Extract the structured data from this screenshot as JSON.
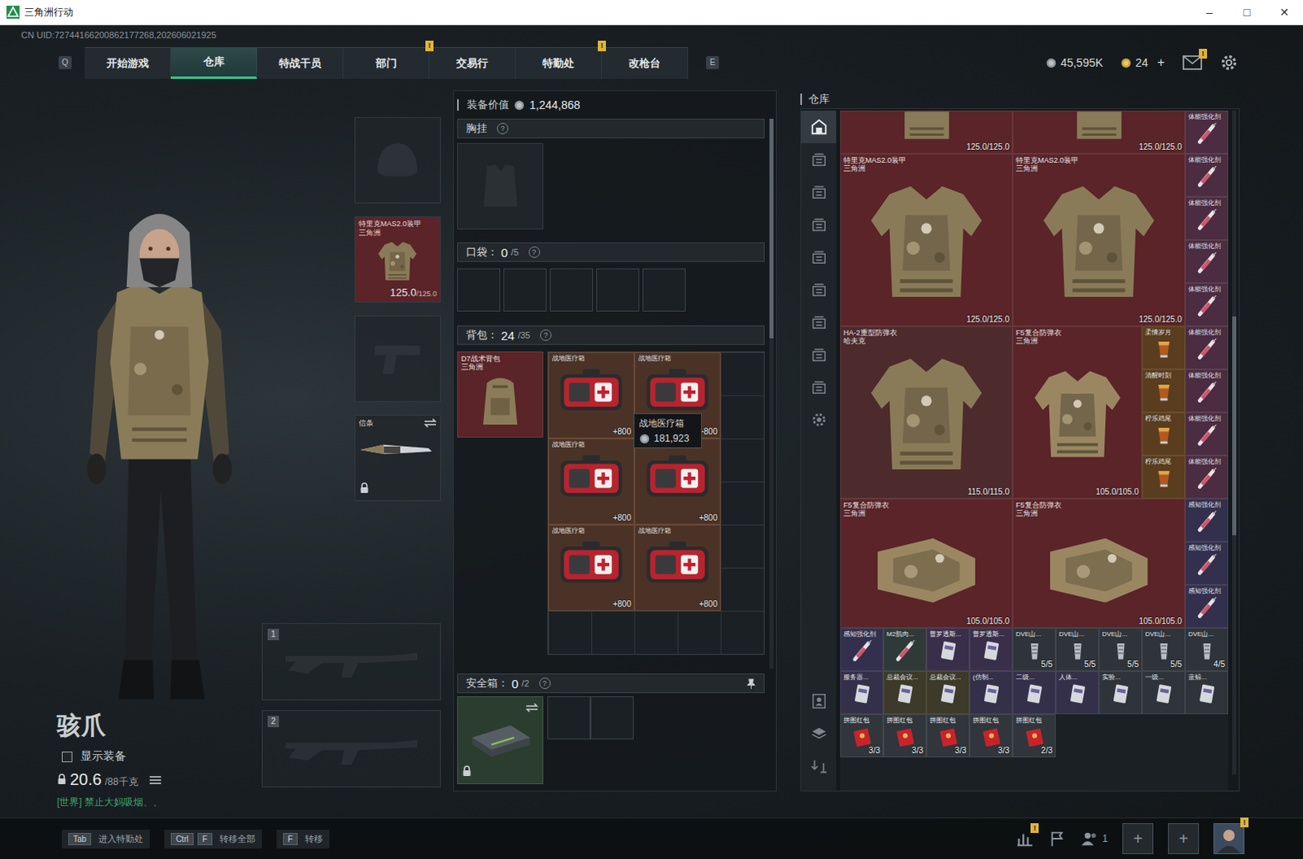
{
  "window": {
    "title": "三角洲行动",
    "controls": [
      "–",
      "□",
      "✕"
    ]
  },
  "uid": "CN UID:72744166200862177268,202606021925",
  "nav": {
    "left_key": "Q",
    "right_key": "E",
    "tabs": [
      {
        "label": "开始游戏",
        "selected": false,
        "badge": ""
      },
      {
        "label": "仓库",
        "selected": true,
        "badge": ""
      },
      {
        "label": "特战干员",
        "selected": false,
        "badge": ""
      },
      {
        "label": "部门",
        "selected": false,
        "badge": "!"
      },
      {
        "label": "交易行",
        "selected": false,
        "badge": ""
      },
      {
        "label": "特勤处",
        "selected": false,
        "badge": "!"
      },
      {
        "label": "改枪台",
        "selected": false,
        "badge": ""
      }
    ]
  },
  "wallet": {
    "coins": "45,595K",
    "tickets": "24",
    "add": "+",
    "mail_badge": "!"
  },
  "operator": {
    "name": "骇爪",
    "show_gear": {
      "label": "显示装备",
      "checked": false
    },
    "weight": "20.6",
    "weight_max": "/88千克",
    "chat": "[世界] 禁止大妈吸烟、、"
  },
  "equipment": [
    {
      "kind": "helmet",
      "filled": false
    },
    {
      "kind": "armor",
      "filled": true,
      "name": "特里克MAS2.0装甲",
      "brand": "三角洲",
      "durability": "125.0",
      "durability_max": "/125.0",
      "color": "#5a2428"
    },
    {
      "kind": "pistol",
      "filled": false
    },
    {
      "kind": "melee",
      "filled": true,
      "name": "信条",
      "locked": true
    }
  ],
  "weapons": [
    {
      "number": "1",
      "filled": false
    },
    {
      "number": "2",
      "filled": false
    }
  ],
  "loadout": {
    "value_label": "装备价值",
    "value": "1,244,868",
    "rig": {
      "label": "胸挂",
      "help": "?",
      "filled": false
    },
    "pockets": {
      "label": "口袋：",
      "count": "0",
      "capacity": "/5",
      "help": "?",
      "slot_count": 5
    },
    "backpack": {
      "label": "背包：",
      "count": "24",
      "capacity": "/35",
      "help": "?",
      "bag": {
        "name": "D7战术背包",
        "brand": "三角洲",
        "color": "#5a2428"
      },
      "items": [
        {
          "name": "战地医疗箱",
          "amount": "+800",
          "color": "#4a3326"
        },
        {
          "name": "战地医疗箱",
          "amount": "+800",
          "color": "#4a3326"
        },
        {
          "name": "战地医疗箱",
          "amount": "+800",
          "color": "#4a3326"
        },
        {
          "name": "战地医疗箱",
          "amount": "+800",
          "color": "#4a3326"
        },
        {
          "name": "战地医疗箱",
          "amount": "+800",
          "color": "#4a3326"
        },
        {
          "name": "战地医疗箱",
          "amount": "+800",
          "color": "#4a3326"
        }
      ],
      "tooltip": {
        "name": "战地医疗箱",
        "value": "181,923"
      }
    },
    "secure": {
      "label": "安全箱：",
      "count": "0",
      "capacity": "/2",
      "help": "?",
      "locked": true,
      "slot_count": 2
    },
    "scrollbar": {
      "position": 0.0,
      "level": 0.4
    }
  },
  "stash": {
    "title": "仓库",
    "sidebar": [
      {
        "kind": "home",
        "selected": true
      },
      {
        "kind": "tab",
        "selected": false
      },
      {
        "kind": "tab",
        "selected": false
      },
      {
        "kind": "tab",
        "selected": false
      },
      {
        "kind": "tab",
        "selected": false
      },
      {
        "kind": "tab",
        "selected": false
      },
      {
        "kind": "tab",
        "selected": false
      },
      {
        "kind": "tab",
        "selected": false
      },
      {
        "kind": "tab",
        "selected": false
      },
      {
        "kind": "settings",
        "selected": false
      }
    ],
    "sidebar_bottom": [
      {
        "kind": "operator"
      },
      {
        "kind": "layers"
      },
      {
        "kind": "transfer"
      }
    ],
    "scrollbar": {
      "position": 0.31,
      "level": 0.33
    },
    "items": [
      {
        "kind": "armor-cut",
        "value": "125.0/125.0",
        "color": "#5a2428"
      },
      {
        "kind": "armor-cut",
        "value": "125.0/125.0",
        "color": "#5a2428"
      },
      {
        "kind": "syringe",
        "name": "体能强化剂",
        "color": "#4b2c40"
      },
      {
        "kind": "armor",
        "name": "特里克MAS2.0装甲",
        "brand": "三角洲",
        "value": "125.0/125.0",
        "color": "#5a2428"
      },
      {
        "kind": "armor",
        "name": "特里克MAS2.0装甲",
        "brand": "三角洲",
        "value": "125.0/125.0",
        "color": "#5a2428"
      },
      {
        "kind": "syringe",
        "name": "体能强化剂",
        "color": "#4b2c40"
      },
      {
        "kind": "syringe",
        "name": "体能强化剂",
        "color": "#4b2c40"
      },
      {
        "kind": "syringe",
        "name": "体能强化剂",
        "color": "#4b2c40"
      },
      {
        "kind": "syringe",
        "name": "体能强化剂",
        "color": "#4b2c40"
      },
      {
        "kind": "armor",
        "name": "HA-2重型防弹衣",
        "brand": "哈夫克",
        "value": "115.0/115.0",
        "color": "#4d2a2c"
      },
      {
        "kind": "vest",
        "name": "F5复合防弹衣",
        "brand": "三角洲",
        "value": "105.0/105.0",
        "color": "#5a2428"
      },
      {
        "kind": "drink",
        "name": "柔情岁月",
        "color": "#5a3d1e"
      },
      {
        "kind": "syringe",
        "name": "体能强化剂",
        "color": "#4b2c40"
      },
      {
        "kind": "drink",
        "name": "清醒时刻",
        "color": "#5a3d1e"
      },
      {
        "kind": "syringe",
        "name": "体能强化剂",
        "color": "#4b2c40"
      },
      {
        "kind": "drink",
        "name": "柠乐鸡尾",
        "color": "#5a3d1e"
      },
      {
        "kind": "syringe",
        "name": "体能强化剂",
        "color": "#4b2c40"
      },
      {
        "kind": "drink",
        "name": "柠乐鸡尾",
        "color": "#5a3d1e"
      },
      {
        "kind": "syringe",
        "name": "体能强化剂",
        "color": "#4b2c40"
      },
      {
        "kind": "plate",
        "name": "F5复合防弹衣",
        "brand": "三角洲",
        "value": "105.0/105.0",
        "color": "#5a2428"
      },
      {
        "kind": "plate",
        "name": "F5复合防弹衣",
        "brand": "三角洲",
        "value": "105.0/105.0",
        "color": "#5a2428"
      },
      {
        "kind": "syringe",
        "name": "感知强化剂",
        "color": "#33304e"
      },
      {
        "kind": "syringe",
        "name": "感知强化剂",
        "color": "#33304e"
      },
      {
        "kind": "syringe",
        "name": "感知强化剂",
        "color": "#33304e"
      },
      {
        "kind": "syringe",
        "name": "感知强化剂",
        "color": "#33304e"
      },
      {
        "kind": "syringe",
        "name": "M2肌肉...",
        "color": "#2f3a38"
      },
      {
        "kind": "card",
        "name": "普罗透斯...",
        "color": "#3a2f4a"
      },
      {
        "kind": "card",
        "name": "普罗透斯...",
        "color": "#3a2f4a"
      },
      {
        "kind": "clip",
        "name": "DVE山...",
        "value": "5/5",
        "color": "#2e3439"
      },
      {
        "kind": "clip",
        "name": "DVE山...",
        "value": "5/5",
        "color": "#2e3439"
      },
      {
        "kind": "clip",
        "name": "DVE山...",
        "value": "5/5",
        "color": "#2e3439"
      },
      {
        "kind": "clip",
        "name": "DVE山...",
        "value": "5/5",
        "color": "#2e3439"
      },
      {
        "kind": "clip",
        "name": "DVE山...",
        "value": "4/5",
        "color": "#2e3439"
      },
      {
        "kind": "card",
        "name": "服务器...",
        "color": "#35304a"
      },
      {
        "kind": "card",
        "name": "总裁会议...",
        "color": "#3d3a2a"
      },
      {
        "kind": "card",
        "name": "总裁会议...",
        "color": "#3d3a2a"
      },
      {
        "kind": "card",
        "name": "(仿制...",
        "color": "#35304a"
      },
      {
        "kind": "card",
        "name": "二级...",
        "color": "#35304a"
      },
      {
        "kind": "card",
        "name": "人体...",
        "color": "#35304a"
      },
      {
        "kind": "card",
        "name": "实验...",
        "color": "#2e3439"
      },
      {
        "kind": "card",
        "name": "一级...",
        "color": "#2e3439"
      },
      {
        "kind": "card",
        "name": "蓝鲸...",
        "color": "#2e3439"
      },
      {
        "kind": "packet",
        "name": "拼图红包",
        "value": "3/3",
        "color": "#30363b"
      },
      {
        "kind": "packet",
        "name": "拼图红包",
        "value": "3/3",
        "color": "#30363b"
      },
      {
        "kind": "packet",
        "name": "拼图红包",
        "value": "3/3",
        "color": "#30363b"
      },
      {
        "kind": "packet",
        "name": "拼图红包",
        "value": "3/3",
        "color": "#30363b"
      },
      {
        "kind": "packet",
        "name": "拼图红包",
        "value": "2/3",
        "color": "#30363b"
      }
    ]
  },
  "hints": [
    {
      "keys": [
        "Tab"
      ],
      "label": "进入特勤处"
    },
    {
      "keys": [
        "Ctrl",
        "F"
      ],
      "label": "转移全部"
    },
    {
      "keys": [
        "F"
      ],
      "label": "转移"
    }
  ],
  "social": {
    "stats_badge": "!",
    "friends": "1",
    "invite_slots": [
      "+",
      "+"
    ],
    "avatar_badge": "!"
  }
}
